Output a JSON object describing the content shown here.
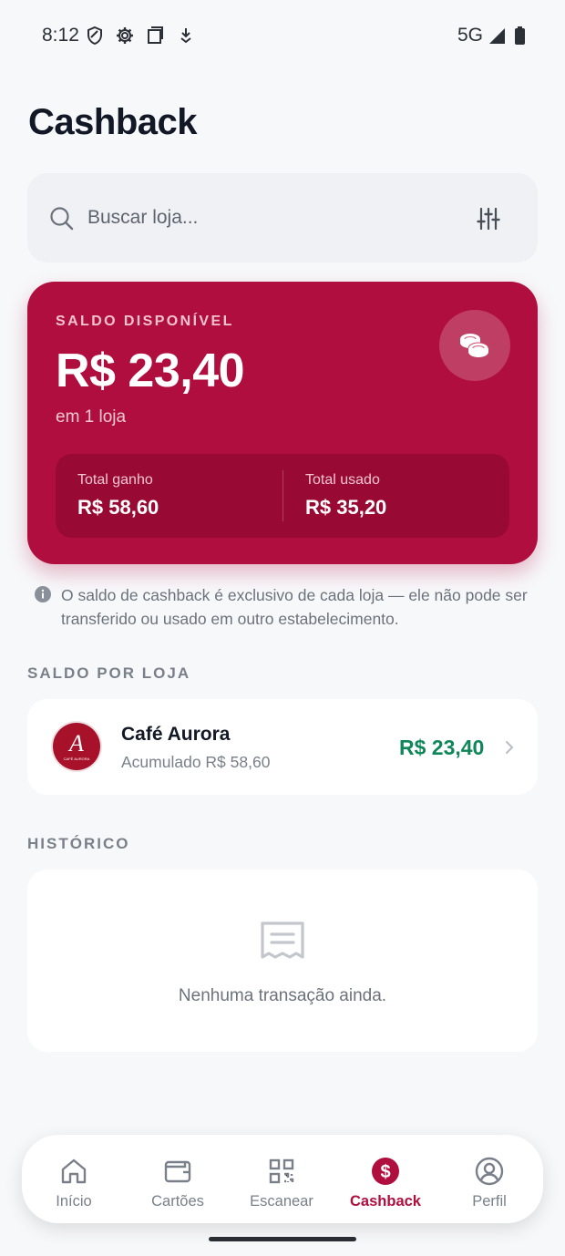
{
  "status_bar": {
    "time": "8:12",
    "network": "5G"
  },
  "page": {
    "title": "Cashback"
  },
  "search": {
    "placeholder": "Buscar loja...",
    "value": ""
  },
  "balance_card": {
    "label": "SALDO DISPONÍVEL",
    "value": "R$ 23,40",
    "subtitle": "em 1 loja",
    "total_earned_label": "Total ganho",
    "total_earned_value": "R$ 58,60",
    "total_used_label": "Total usado",
    "total_used_value": "R$ 35,20",
    "accent_color": "#b00e3e"
  },
  "info_note": "O saldo de cashback é exclusivo de cada loja — ele não pode ser transferido ou usado em outro estabelecimento.",
  "stores_section": {
    "title": "SALDO POR LOJA",
    "items": [
      {
        "name": "Café Aurora",
        "accumulated": "Acumulado R$ 58,60",
        "balance": "R$ 23,40",
        "logo_letter": "A",
        "logo_caption": "CAFÉ AURORA",
        "balance_color": "#10875a"
      }
    ]
  },
  "history_section": {
    "title": "HISTÓRICO",
    "empty_text": "Nenhuma transação ainda."
  },
  "bottom_nav": {
    "items": [
      {
        "label": "Início",
        "icon": "home-icon",
        "active": false
      },
      {
        "label": "Cartões",
        "icon": "wallet-icon",
        "active": false
      },
      {
        "label": "Escanear",
        "icon": "qr-code-icon",
        "active": false
      },
      {
        "label": "Cashback",
        "icon": "dollar-icon",
        "active": true
      },
      {
        "label": "Perfil",
        "icon": "user-icon",
        "active": false
      }
    ]
  }
}
